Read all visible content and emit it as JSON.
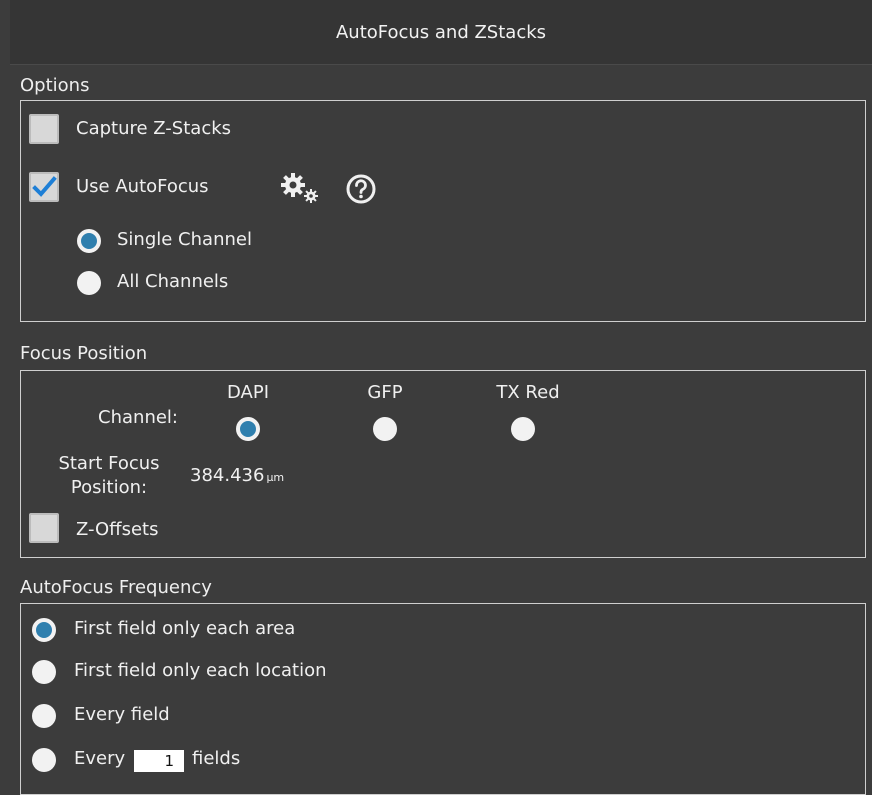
{
  "window": {
    "title": "AutoFocus and ZStacks"
  },
  "options": {
    "label": "Options",
    "capture_zstacks": {
      "label": "Capture Z-Stacks",
      "checked": false
    },
    "use_autofocus": {
      "label": "Use AutoFocus",
      "checked": true,
      "settings_icon": "gear-icon",
      "help_icon": "help-icon"
    },
    "channel_mode": {
      "options": [
        {
          "label": "Single Channel",
          "selected": true
        },
        {
          "label": "All Channels",
          "selected": false
        }
      ]
    }
  },
  "focus_position": {
    "label": "Focus Position",
    "channel_label": "Channel:",
    "channels": [
      {
        "name": "DAPI",
        "selected": true
      },
      {
        "name": "GFP",
        "selected": false
      },
      {
        "name": "TX Red",
        "selected": false
      }
    ],
    "start_focus_label_line1": "Start Focus",
    "start_focus_label_line2": "Position:",
    "start_focus_value": "384.436",
    "start_focus_unit": "µm",
    "z_offsets": {
      "label": "Z-Offsets",
      "checked": false
    }
  },
  "frequency": {
    "label": "AutoFocus Frequency",
    "options": [
      {
        "label": "First field only each area",
        "selected": true
      },
      {
        "label": "First field only each location",
        "selected": false
      },
      {
        "label": "Every field",
        "selected": false
      }
    ],
    "every_n": {
      "prefix": "Every",
      "value": "1",
      "suffix": "fields",
      "selected": false
    }
  },
  "colors": {
    "accent": "#2f7fae",
    "check": "#1e7fd6",
    "background": "#3c3c3c",
    "border": "#cfcfcf"
  }
}
